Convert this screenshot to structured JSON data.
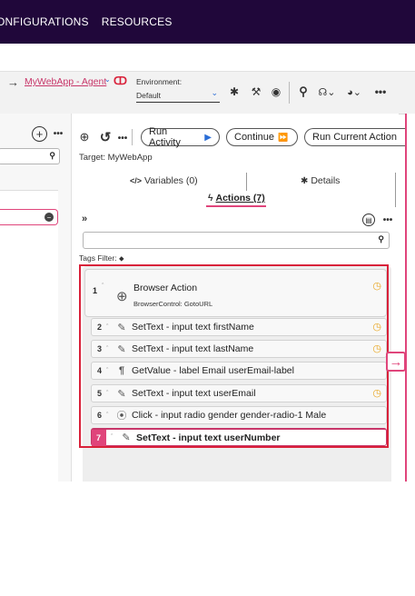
{
  "top_nav": {
    "items": [
      "ONFIGURATIONS",
      "RESOURCES"
    ]
  },
  "toolbar": {
    "app_name": "MyWebApp - Agent",
    "environment_label": "Environment:",
    "environment_value": "Default"
  },
  "left": {
    "search_placeholder": ""
  },
  "right": {
    "buttons": {
      "run_activity": "Run Activity",
      "continue": "Continue",
      "run_current": "Run Current Action"
    },
    "target": "Target: MyWebApp",
    "tabs": {
      "variables": "Variables (0)",
      "details": "Details",
      "actions": "Actions (7)"
    },
    "tags_filter": "Tags Filter:",
    "actions": [
      {
        "num": "1",
        "title": "Browser Action",
        "subtitle": "BrowserControl: GotoURL",
        "icon": "globe-icon",
        "has_clock": true
      },
      {
        "num": "2",
        "title": "SetText - input text firstName",
        "icon": "pencil-icon",
        "has_clock": true
      },
      {
        "num": "3",
        "title": "SetText - input text lastName",
        "icon": "pencil-icon",
        "has_clock": true
      },
      {
        "num": "4",
        "title": "GetValue - label Email userEmail-label",
        "icon": "paragraph-icon",
        "has_clock": false
      },
      {
        "num": "5",
        "title": "SetText - input text userEmail",
        "icon": "pencil-icon",
        "has_clock": true
      },
      {
        "num": "6",
        "title": "Click - input radio gender gender-radio-1 Male",
        "icon": "radio-icon",
        "has_clock": false
      },
      {
        "num": "7",
        "title": "SetText - input text userNumber",
        "icon": "pencil-icon",
        "has_clock": false,
        "selected": true
      }
    ]
  },
  "colors": {
    "topbar": "#20073a",
    "accent": "#e0457b",
    "highlight_box": "#d9213a",
    "clock": "#e8a31a"
  }
}
